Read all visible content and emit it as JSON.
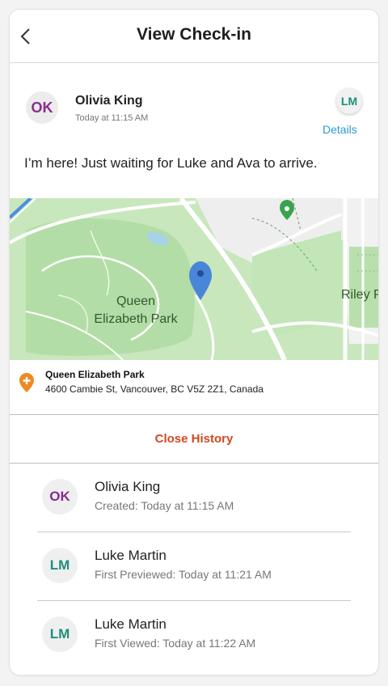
{
  "header": {
    "title": "View Check-in",
    "back_icon": "chevron-left-icon"
  },
  "author": {
    "initials": "OK",
    "name": "Olivia King",
    "time": "Today at 11:15 AM",
    "color": "#8a2c8e"
  },
  "recipient": {
    "initials": "LM",
    "color": "#1e8e7a"
  },
  "details_label": "Details",
  "message": "I’m here! Just waiting for Luke and Ava to arrive.",
  "map": {
    "park_label_line1": "Queen",
    "park_label_line2": "Elizabeth Park",
    "side_label": "Riley P",
    "pin_icon": "map-pin-icon",
    "poi_icon": "poi-pin-icon"
  },
  "location": {
    "icon": "location-marker-icon",
    "name": "Queen Elizabeth Park",
    "address": "4600 Cambie St, Vancouver, BC V5Z 2Z1, Canada"
  },
  "close_history_label": "Close History",
  "accent_color": "#d2481f",
  "link_color": "#2a9ad1",
  "history": [
    {
      "initials": "OK",
      "name": "Olivia King",
      "detail": "Created: Today at 11:15 AM",
      "color": "#8a2c8e"
    },
    {
      "initials": "LM",
      "name": "Luke Martin",
      "detail": "First Previewed: Today at 11:21 AM",
      "color": "#1e8e7a"
    },
    {
      "initials": "LM",
      "name": "Luke Martin",
      "detail": "First Viewed: Today at 11:22 AM",
      "color": "#1e8e7a"
    }
  ]
}
